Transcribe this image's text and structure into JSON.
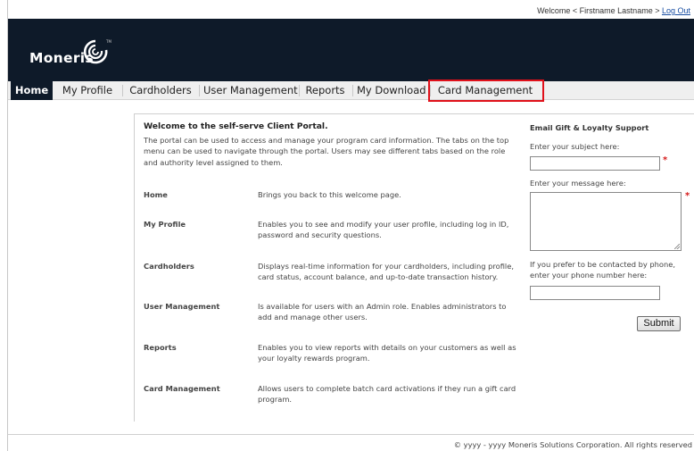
{
  "topbar": {
    "welcome_text": "Welcome < Firstname Lastname >",
    "logout_label": "Log Out"
  },
  "brand": {
    "logo_text": "Moneris",
    "trademark": "TM",
    "header_color": "#0e1a29"
  },
  "nav": {
    "items": [
      {
        "label": "Home",
        "active": true
      },
      {
        "label": "My Profile",
        "active": false
      },
      {
        "label": "Cardholders",
        "active": false
      },
      {
        "label": "User Management",
        "active": false
      },
      {
        "label": "Reports",
        "active": false
      },
      {
        "label": "My Download",
        "active": false
      },
      {
        "label": "Card Management",
        "active": false,
        "highlighted": true
      }
    ],
    "highlight_color": "#e0101a"
  },
  "main": {
    "welcome_title": "Welcome to the self-serve Client Portal.",
    "intro": "The portal can be used to access and manage your program card information. The tabs on the top menu can be used to navigate through the portal. Users may see different tabs based on the role and authority level assigned to them.",
    "features": [
      {
        "title": "Home",
        "description": "Brings you back to this welcome page."
      },
      {
        "title": "My Profile",
        "description": "Enables you to see and modify your user profile, including log in ID, password and security questions."
      },
      {
        "title": "Cardholders",
        "description": "Displays real-time information for your cardholders, including profile, card status, account balance, and up-to-date transaction history."
      },
      {
        "title": "User Management",
        "description": "Is available for users with an Admin role. Enables administrators to add and manage other users."
      },
      {
        "title": "Reports",
        "description": "Enables you to view reports with details on your customers as well as your loyalty rewards program."
      },
      {
        "title": "Card Management",
        "description": "Allows users to complete batch card activations if they run a gift card program."
      }
    ]
  },
  "support": {
    "title": "Email Gift & Loyalty Support",
    "subject_label": "Enter your subject here:",
    "subject_value": "",
    "message_label": "Enter your message here:",
    "message_value": "",
    "phone_label": "If you prefer to be contacted by phone, enter your phone number here:",
    "phone_value": "",
    "required_mark": "*",
    "submit_label": "Submit"
  },
  "footer": {
    "copyright": "©  yyyy - yyyy   Moneris Solutions Corporation. All rights reserved"
  }
}
